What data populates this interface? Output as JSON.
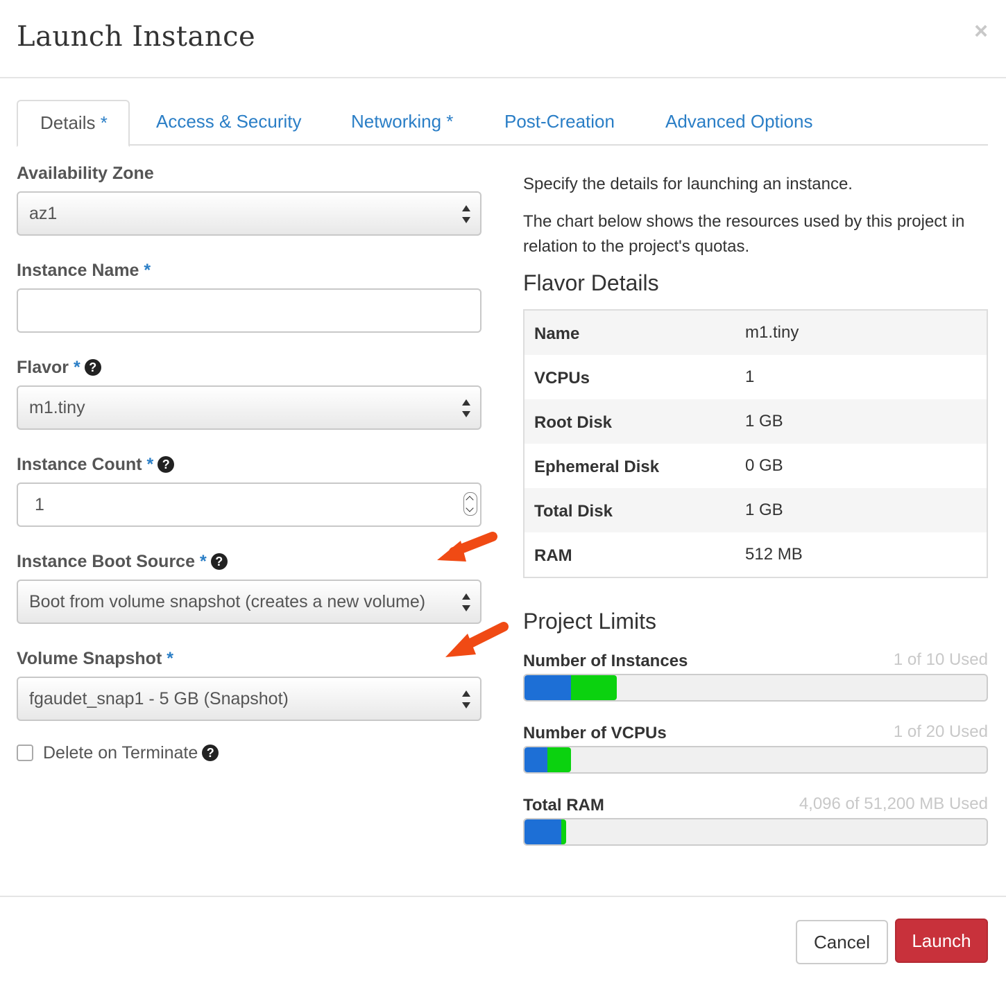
{
  "modal": {
    "title": "Launch Instance",
    "close_icon": "close-icon"
  },
  "tabs": [
    {
      "label": "Details",
      "required": "*",
      "active": true
    },
    {
      "label": "Access & Security",
      "required": ""
    },
    {
      "label": "Networking",
      "required": "*"
    },
    {
      "label": "Post-Creation",
      "required": ""
    },
    {
      "label": "Advanced Options",
      "required": ""
    }
  ],
  "form": {
    "availability_zone": {
      "label": "Availability Zone",
      "value": "az1"
    },
    "instance_name": {
      "label": "Instance Name",
      "required": "*",
      "value": ""
    },
    "flavor": {
      "label": "Flavor",
      "required": "*",
      "value": "m1.tiny",
      "help_icon": "question-circle-icon"
    },
    "instance_count": {
      "label": "Instance Count",
      "required": "*",
      "value": "1",
      "help_icon": "question-circle-icon"
    },
    "boot_source": {
      "label": "Instance Boot Source",
      "required": "*",
      "value": "Boot from volume snapshot (creates a new volume)",
      "help_icon": "question-circle-icon"
    },
    "volume_snapshot": {
      "label": "Volume Snapshot",
      "required": "*",
      "value": "fgaudet_snap1 - 5 GB (Snapshot)"
    },
    "delete_on_terminate": {
      "label": "Delete on Terminate",
      "checked": false,
      "help_icon": "question-circle-icon"
    }
  },
  "annotations": {
    "arrow_color": "#f04a14"
  },
  "info": {
    "line1": "Specify the details for launching an instance.",
    "line2": "The chart below shows the resources used by this project in relation to the project's quotas."
  },
  "flavor_details": {
    "title": "Flavor Details",
    "rows": [
      {
        "key": "Name",
        "value": "m1.tiny"
      },
      {
        "key": "VCPUs",
        "value": "1"
      },
      {
        "key": "Root Disk",
        "value": "1 GB"
      },
      {
        "key": "Ephemeral Disk",
        "value": "0 GB"
      },
      {
        "key": "Total Disk",
        "value": "1 GB"
      },
      {
        "key": "RAM",
        "value": "512 MB"
      }
    ]
  },
  "project_limits": {
    "title": "Project Limits",
    "colors": {
      "current": "#1d6fd6",
      "added": "#0bd20f"
    },
    "items": [
      {
        "label": "Number of Instances",
        "used_text": "1 of 10 Used",
        "current_fraction": 0.1,
        "added_fraction": 0.1
      },
      {
        "label": "Number of VCPUs",
        "used_text": "1 of 20 Used",
        "current_fraction": 0.05,
        "added_fraction": 0.05
      },
      {
        "label": "Total RAM",
        "used_text": "4,096 of 51,200 MB Used",
        "current_fraction": 0.08,
        "added_fraction": 0.01
      }
    ]
  },
  "footer": {
    "cancel_label": "Cancel",
    "launch_label": "Launch"
  }
}
